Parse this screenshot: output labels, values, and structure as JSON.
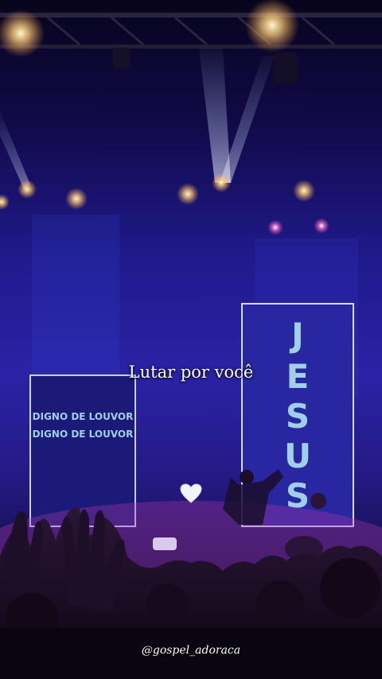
{
  "caption": "Lutar por você",
  "handle": "@gospel_adoraca",
  "left_banner": {
    "line1": "DIGNO DE LOUVOR",
    "line2": "DIGNO DE LOUVOR"
  },
  "right_banner": {
    "letters": [
      "J",
      "E",
      "S",
      "U",
      "S"
    ]
  },
  "icons": {
    "heart": "white-heart-emoji"
  },
  "colors": {
    "stage_purple": "#2a22a6",
    "banner_text": "#9fd0e8",
    "caption": "#ffffff"
  }
}
